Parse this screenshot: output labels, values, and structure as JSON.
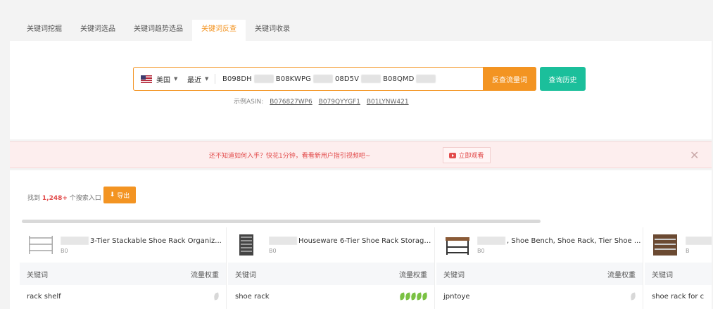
{
  "tabs": [
    {
      "label": "关键词挖掘",
      "active": false
    },
    {
      "label": "关键词选品",
      "active": false
    },
    {
      "label": "关键词趋势选品",
      "active": false
    },
    {
      "label": "关键词反查",
      "active": true
    },
    {
      "label": "关键词收录",
      "active": false
    }
  ],
  "search": {
    "country": "美国",
    "range": "最近",
    "asin_parts": [
      "B098DH",
      "B08KWPG",
      "08D5V",
      "B08QMD"
    ],
    "submit_label": "反查流量词",
    "history_label": "查询历史",
    "examples_prefix": "示例ASIN:",
    "examples": [
      "B076827WP6",
      "B079QYYGF1",
      "B01LYNW421"
    ]
  },
  "banner": {
    "text": "还不知道如何入手？快花1分钟，看看新用户指引视频吧~",
    "watch_label": "立即观看",
    "close_glyph": "✕"
  },
  "results": {
    "count_prefix": "找到",
    "count": "1,248+",
    "count_suffix": "个搜索入口",
    "export_label": "导出"
  },
  "cards": [
    {
      "title": "3-Tier Stackable Shoe Rack Organiz...",
      "sub": "B0",
      "col_keyword": "关键词",
      "col_weight": "流量权重",
      "rows": [
        {
          "keyword": "rack shelf",
          "weight": 1,
          "weight_on": 0
        }
      ]
    },
    {
      "title": "Houseware 6-Tier Shoe Rack Storage...",
      "sub": "B0",
      "col_keyword": "关键词",
      "col_weight": "流量权重",
      "rows": [
        {
          "keyword": "shoe rack",
          "weight": 5,
          "weight_on": 5
        }
      ]
    },
    {
      "title": ", Shoe Bench, Shoe Rack, Tier Shoe ...",
      "sub": "B0",
      "col_keyword": "关键词",
      "col_weight": "流量权重",
      "rows": [
        {
          "keyword": "jpntoye",
          "weight": 1,
          "weight_on": 0
        }
      ]
    },
    {
      "title": "",
      "sub": "B",
      "col_keyword": "关键词",
      "col_weight": "",
      "rows": [
        {
          "keyword": "shoe rack for c",
          "weight": 0,
          "weight_on": 0
        }
      ]
    }
  ],
  "colors": {
    "accent": "#f39422",
    "teal": "#1bbf9b",
    "alert": "#e24c4c",
    "leaf": "#7ac143"
  }
}
